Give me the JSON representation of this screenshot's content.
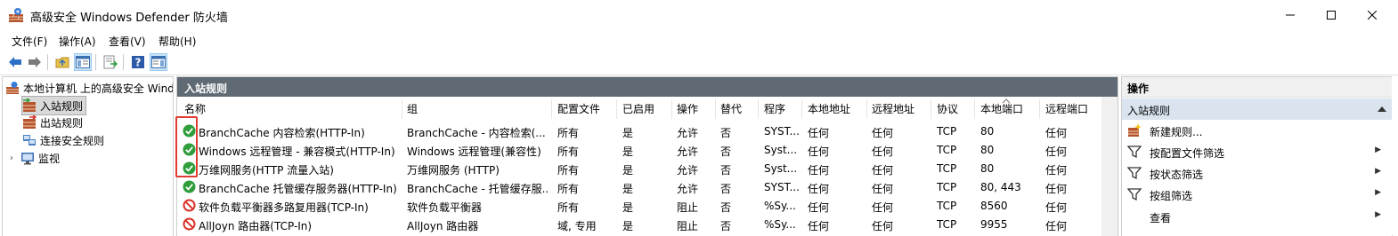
{
  "window": {
    "title": "高级安全 Windows Defender 防火墙",
    "minimize_icon": "minimize-icon",
    "maximize_icon": "maximize-icon",
    "close_icon": "close-icon"
  },
  "menu": [
    {
      "label": "文件(F)"
    },
    {
      "label": "操作(A)"
    },
    {
      "label": "查看(V)"
    },
    {
      "label": "帮助(H)"
    }
  ],
  "toolbar": {
    "icons": [
      "back-arrow-icon",
      "forward-arrow-icon",
      "up-folder-icon",
      "show-hide-console-tree-icon",
      "export-list-icon",
      "help-icon",
      "show-hide-action-pane-icon"
    ]
  },
  "tree": {
    "root": "本地计算机 上的高级安全 Windows Defender 防火墙",
    "items": [
      {
        "label": "入站规则",
        "selected": true
      },
      {
        "label": "出站规则"
      },
      {
        "label": "连接安全规则"
      },
      {
        "label": "监视"
      }
    ]
  },
  "center": {
    "header": "入站规则",
    "columns": [
      "名称",
      "组",
      "配置文件",
      "已启用",
      "操作",
      "替代",
      "程序",
      "本地地址",
      "远程地址",
      "协议",
      "本地端口",
      "远程端口"
    ],
    "rows": [
      {
        "status": "allow",
        "name": "BranchCache 内容检索(HTTP-In)",
        "group": "BranchCache - 内容检索(...",
        "profile": "所有",
        "enabled": "是",
        "action": "允许",
        "override": "否",
        "program": "SYST...",
        "local_addr": "任何",
        "remote_addr": "任何",
        "protocol": "TCP",
        "local_port": "80",
        "remote_port": "任何"
      },
      {
        "status": "allow",
        "name": "Windows 远程管理 - 兼容模式(HTTP-In)",
        "group": "Windows 远程管理(兼容性)",
        "profile": "所有",
        "enabled": "是",
        "action": "允许",
        "override": "否",
        "program": "Syst...",
        "local_addr": "任何",
        "remote_addr": "任何",
        "protocol": "TCP",
        "local_port": "80",
        "remote_port": "任何"
      },
      {
        "status": "allow",
        "name": "万维网服务(HTTP 流量入站)",
        "group": "万维网服务 (HTTP)",
        "profile": "所有",
        "enabled": "是",
        "action": "允许",
        "override": "否",
        "program": "Syst...",
        "local_addr": "任何",
        "remote_addr": "任何",
        "protocol": "TCP",
        "local_port": "80",
        "remote_port": "任何"
      },
      {
        "status": "allow",
        "name": "BranchCache 托管缓存服务器(HTTP-In)",
        "group": "BranchCache - 托管缓存服...",
        "profile": "所有",
        "enabled": "是",
        "action": "允许",
        "override": "否",
        "program": "SYST...",
        "local_addr": "任何",
        "remote_addr": "任何",
        "protocol": "TCP",
        "local_port": "80, 443",
        "remote_port": "任何"
      },
      {
        "status": "block",
        "name": "软件负载平衡器多路复用器(TCP-In)",
        "group": "软件负载平衡器",
        "profile": "所有",
        "enabled": "是",
        "action": "阻止",
        "override": "否",
        "program": "%Sy...",
        "local_addr": "任何",
        "remote_addr": "任何",
        "protocol": "TCP",
        "local_port": "8560",
        "remote_port": "任何"
      },
      {
        "status": "block",
        "name": "AllJoyn 路由器(TCP-In)",
        "group": "AllJoyn 路由器",
        "profile": "域, 专用",
        "enabled": "是",
        "action": "阻止",
        "override": "否",
        "program": "%Sy...",
        "local_addr": "任何",
        "remote_addr": "任何",
        "protocol": "TCP",
        "local_port": "9955",
        "remote_port": "任何"
      }
    ]
  },
  "actions": {
    "title": "操作",
    "section": "入站规则",
    "items": [
      {
        "label": "新建规则...",
        "icon": "new-rule-icon",
        "submenu": false
      },
      {
        "label": "按配置文件筛选",
        "icon": "filter-icon",
        "submenu": true
      },
      {
        "label": "按状态筛选",
        "icon": "filter-icon",
        "submenu": true
      },
      {
        "label": "按组筛选",
        "icon": "filter-icon",
        "submenu": true
      },
      {
        "label": "查看",
        "icon": "",
        "submenu": true
      }
    ]
  },
  "colors": {
    "allow": "#2e9d3a",
    "block": "#d9342b",
    "center_header_bg": "#5f6a74",
    "highlight_box": "#e03c31"
  }
}
